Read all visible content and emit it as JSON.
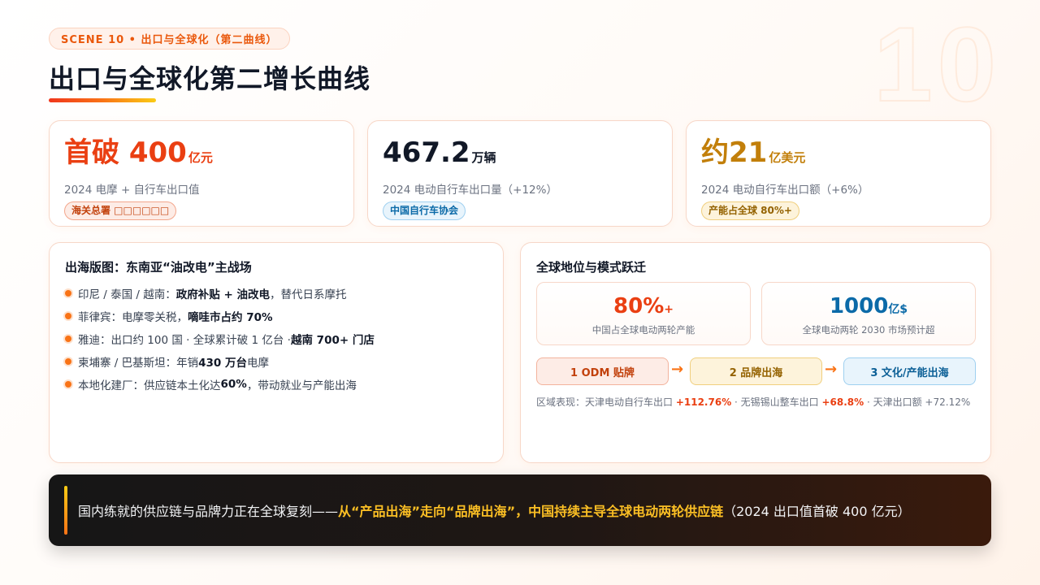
{
  "scene": {
    "number": "10",
    "tag": "SCENE 10 • 出口与全球化（第二曲线）"
  },
  "page": {
    "title": "出口与全球化第二增长曲线"
  },
  "stats": [
    {
      "value": "首破 400",
      "unit": "亿元",
      "desc": "2024 电摩 + 自行车出口值",
      "badge": "海关总署 □□□□□□",
      "color": "#ea3f12"
    },
    {
      "value": "467.2",
      "unit": "万辆",
      "desc": "2024 电动自行车出口量（+12%）",
      "badge": "中国自行车协会",
      "color": "#111827"
    },
    {
      "value": "约21",
      "unit": "亿美元",
      "desc": "2024 电动自行车出口额（+6%）",
      "badge": "产能占全球 80%+",
      "color": "#c27f0a"
    }
  ],
  "overseas": {
    "title": "出海版图：东南亚“油改电”主战场",
    "items": [
      {
        "pre": "印尼 / 泰国 / 越南：",
        "bold": "政府补贴 + 油改电",
        "post": "，替代日系摩托"
      },
      {
        "pre": "菲律宾：电摩零关税，",
        "bold": "嘀哇市占约 70%",
        "post": ""
      },
      {
        "pre": "雅迪：出口约 100 国 · 全球累计破 1 亿台 · ",
        "bold": "越南 700+ 门店",
        "post": ""
      },
      {
        "pre": "柬埔寨 / 巴基斯坦：年销 ",
        "bold": "430 万台",
        "post": "电摩"
      },
      {
        "pre": "本地化建厂：供应链本土化达 ",
        "bold": "60%",
        "post": "，带动就业与产能出海"
      }
    ]
  },
  "global": {
    "title": "全球地位与模式跃迁",
    "metrics": [
      {
        "value": "80%",
        "suffix": "+",
        "desc": "中国占全球电动两轮产能",
        "color": "#ea3f12"
      },
      {
        "value": "1000",
        "suffix": "亿$",
        "desc": "全球电动两轮 2030 市场预计超",
        "color": "#0b6aa8"
      }
    ],
    "flow": [
      "1 ODM 贴牌",
      "2 品牌出海",
      "3 文化/产能出海"
    ],
    "arrow": "→",
    "region": {
      "label": "区域表现：天津电动自行车出口 ",
      "v1": "+112.76%",
      "mid": " · 无锡锡山整车出口 ",
      "v2": "+68.8%",
      "tail": " · 天津出口额 +72.12%"
    }
  },
  "banner": {
    "pre": "国内练就的供应链与品牌力正在全球复刻——",
    "highlight": "从“产品出海”走向“品牌出海”，中国持续主导全球电动两轮供应链",
    "post": "（2024 出口值首破 400 亿元）"
  }
}
